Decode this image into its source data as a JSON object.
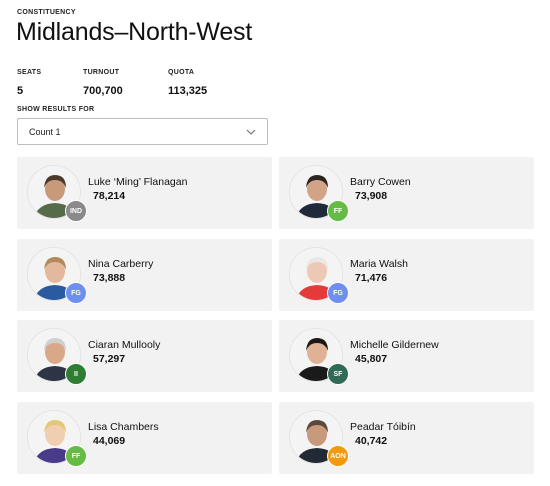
{
  "header": {
    "eyebrow": "CONSTITUENCY",
    "title": "Midlands–North-West"
  },
  "stats": {
    "seats_label": "SEATS",
    "seats_value": "5",
    "turnout_label": "TURNOUT",
    "turnout_value": "700,700",
    "quota_label": "QUOTA",
    "quota_value": "113,325"
  },
  "results_select": {
    "label": "SHOW RESULTS FOR",
    "selected": "Count 1"
  },
  "party_colors": {
    "IND": "#8a8a8a",
    "FF": "#66bb44",
    "FG": "#6f8ff0",
    "II": "#2e7d32",
    "SF": "#2f6b57",
    "AON": "#f29a0c"
  },
  "candidates": [
    {
      "name": "Luke ‘Ming’ Flanagan",
      "votes": "78,214",
      "party": "IND"
    },
    {
      "name": "Barry Cowen",
      "votes": "73,908",
      "party": "FF"
    },
    {
      "name": "Nina Carberry",
      "votes": "73,888",
      "party": "FG"
    },
    {
      "name": "Maria Walsh",
      "votes": "71,476",
      "party": "FG"
    },
    {
      "name": "Ciaran Mullooly",
      "votes": "57,297",
      "party": "II"
    },
    {
      "name": "Michelle Gildernew",
      "votes": "45,807",
      "party": "SF"
    },
    {
      "name": "Lisa Chambers",
      "votes": "44,069",
      "party": "FF"
    },
    {
      "name": "Peadar Tóibín",
      "votes": "40,742",
      "party": "AON"
    }
  ]
}
